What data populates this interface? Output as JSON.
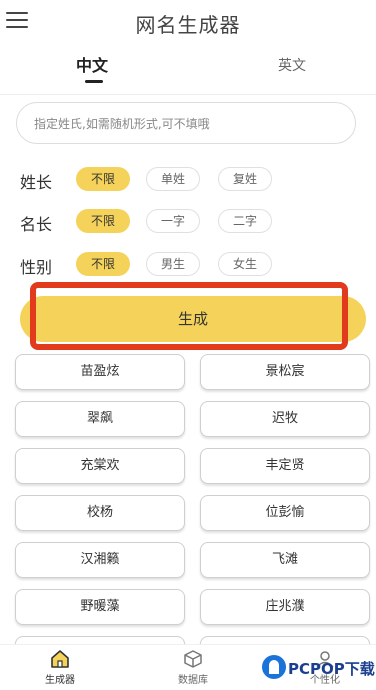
{
  "header": {
    "title": "网名生成器",
    "menu_icon": "hamburger-menu-icon"
  },
  "tabs": [
    {
      "label": "中文",
      "active": true
    },
    {
      "label": "英文",
      "active": false
    }
  ],
  "search": {
    "placeholder": "指定姓氏,如需随机形式,可不填哦"
  },
  "options": [
    {
      "label": "姓长",
      "choices": [
        "不限",
        "单姓",
        "复姓"
      ],
      "selected": "不限"
    },
    {
      "label": "名长",
      "choices": [
        "不限",
        "一字",
        "二字"
      ],
      "selected": "不限"
    },
    {
      "label": "性别",
      "choices": [
        "不限",
        "男生",
        "女生"
      ],
      "selected": "不限"
    }
  ],
  "generate_button": {
    "label": "生成"
  },
  "results": [
    "苗盈炫",
    "景松宸",
    "翠飙",
    "迟牧",
    "充棠欢",
    "丰定贤",
    "校杨",
    "位彭愉",
    "汉湘籁",
    "飞滩",
    "野暖藻",
    "庄兆濮"
  ],
  "bottom_nav": [
    {
      "label": "生成器",
      "icon": "home-icon",
      "active": true
    },
    {
      "label": "数据库",
      "icon": "cube-icon",
      "active": false
    },
    {
      "label": "个性化",
      "icon": "person-icon",
      "active": false
    }
  ],
  "watermark": {
    "text": "PCPOP下载"
  },
  "colors": {
    "accent": "#f5d35a",
    "highlight_border": "#e23a1d",
    "watermark_blue": "#1a73d9"
  }
}
